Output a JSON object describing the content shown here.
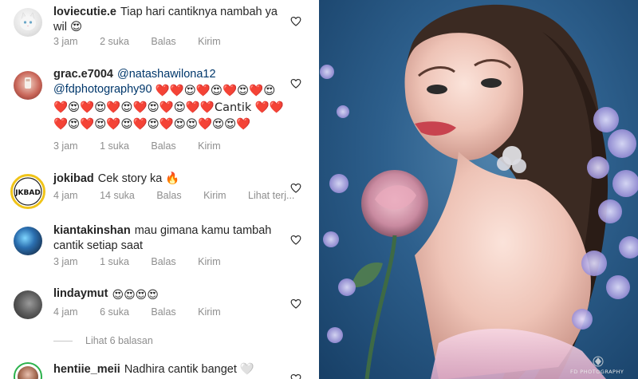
{
  "comments": [
    {
      "username": "loviecutie.e",
      "text": "Tiap hari cantiknya nambah ya wil 😍",
      "time": "3 jam",
      "likes": "2 suka",
      "reply": "Balas",
      "send": "Kirim"
    },
    {
      "username": "grac.e7004",
      "mention1": "@natashawilona12",
      "mention2": "@fdphotography90",
      "text": "❤️❤️😍❤️😍❤️😍❤️😍❤️😍❤️😍❤️😍❤️😍❤️😍❤️❤️Cantik ❤️❤️❤️😍❤️😍❤️😍❤️😍❤️😍😍❤️😍😍❤️",
      "time": "3 jam",
      "likes": "1 suka",
      "reply": "Balas",
      "send": "Kirim"
    },
    {
      "username": "jokibad",
      "text": "Cek story ka 🔥",
      "time": "4 jam",
      "likes": "14 suka",
      "reply": "Balas",
      "send": "Kirim",
      "translate": "Lihat terj..."
    },
    {
      "username": "kiantakinshan",
      "text": "mau gimana kamu tambah cantik setiap saat",
      "time": "3 jam",
      "likes": "1 suka",
      "reply": "Balas",
      "send": "Kirim"
    },
    {
      "username": "lindaymut",
      "text": "😍😍😍😍",
      "time": "4 jam",
      "likes": "6 suka",
      "reply": "Balas",
      "send": "Kirim"
    },
    {
      "username": "hentiie_meii",
      "text": "Nadhira cantik banget 🤍"
    }
  ],
  "view_replies": "Lihat 6 balasan",
  "watermark": "FD PHOTOGRAPHY",
  "colors": {
    "meta_gray": "#8e8e8e",
    "mention_blue": "#00376b",
    "heart_red": "#ed4956"
  }
}
